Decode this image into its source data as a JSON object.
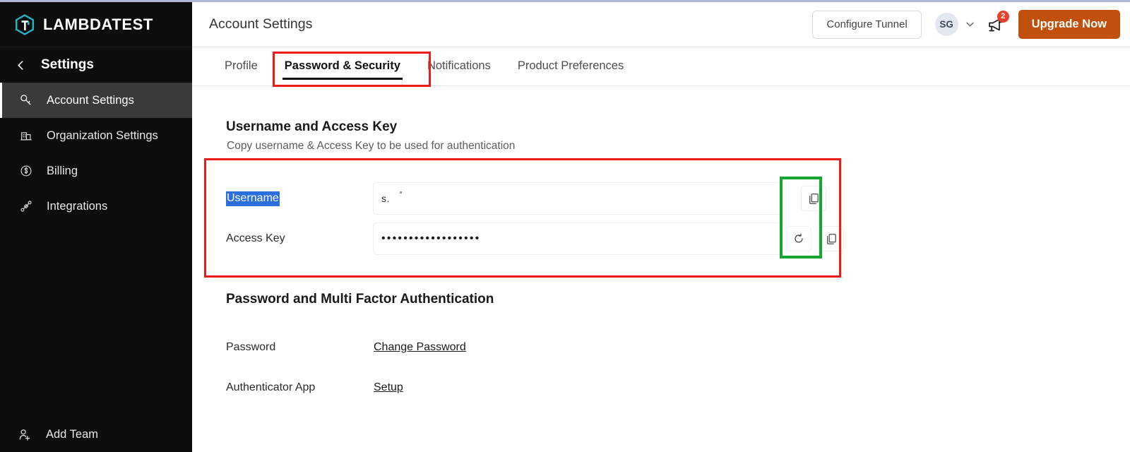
{
  "brand": {
    "name": "LAMBDATEST",
    "logo_icon": "lambdatest-hexagon-icon",
    "accent_color": "#24b3c4"
  },
  "sidebar": {
    "header": {
      "label": "Settings",
      "back_icon": "chevron-left-icon"
    },
    "items": [
      {
        "label": "Account Settings",
        "icon": "key-icon",
        "active": true
      },
      {
        "label": "Organization Settings",
        "icon": "building-icon",
        "active": false
      },
      {
        "label": "Billing",
        "icon": "dollar-circle-icon",
        "active": false
      },
      {
        "label": "Integrations",
        "icon": "plug-connector-icon",
        "active": false
      }
    ],
    "footer": {
      "label": "Add Team",
      "icon": "user-plus-icon"
    },
    "background_color": "#0d0d0d",
    "active_background_color": "#3a3a3a"
  },
  "topbar": {
    "title": "Account Settings",
    "configure_tunnel_label": "Configure Tunnel",
    "avatar_initials": "SG",
    "caret_icon": "chevron-down-icon",
    "announcement_icon": "megaphone-icon",
    "announcement_count": "2",
    "badge_color": "#e8412c",
    "upgrade_label": "Upgrade Now",
    "upgrade_color": "#c2500d"
  },
  "tabs": [
    {
      "label": "Profile",
      "active": false
    },
    {
      "label": "Password & Security",
      "active": true
    },
    {
      "label": "Notifications",
      "active": false
    },
    {
      "label": "Product Preferences",
      "active": false
    }
  ],
  "main": {
    "access_section": {
      "title": "Username and Access Key",
      "subtitle": "Copy username & Access Key to be used for authentication",
      "username_row": {
        "label": "Username",
        "label_selected": true,
        "value": "s.",
        "copy_icon": "copy-icon"
      },
      "access_key_row": {
        "label": "Access Key",
        "value": "••••••••••••••••••",
        "regenerate_icon": "refresh-icon",
        "copy_icon": "copy-icon"
      }
    },
    "mfa_section": {
      "title": "Password and Multi Factor Authentication",
      "rows": [
        {
          "label": "Password",
          "action": "Change Password"
        },
        {
          "label": "Authenticator App",
          "action": "Setup"
        }
      ]
    }
  },
  "annotations": [
    {
      "name": "tab-highlight",
      "color": "#ee1b1b",
      "shape": "rectangle"
    },
    {
      "name": "credentials-highlight",
      "color": "#ee1b1b",
      "shape": "rectangle"
    },
    {
      "name": "copy-buttons-highlight",
      "color": "#16a532",
      "shape": "rectangle"
    }
  ]
}
